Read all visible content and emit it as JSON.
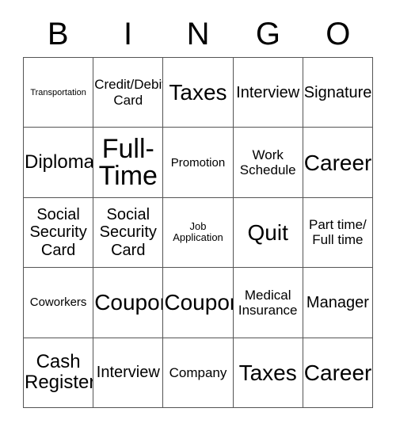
{
  "card": {
    "title": "BINGO",
    "header_letters": [
      "B",
      "I",
      "N",
      "G",
      "O"
    ],
    "colors": {
      "background": "#ffffff",
      "cell_background": "#ffffff",
      "border": "#555555",
      "text": "#000000"
    },
    "grid_size": {
      "columns": 5,
      "rows": 5
    },
    "cells": [
      [
        {
          "label": "Transportation",
          "size": "xxs"
        },
        {
          "label": "Credit/Debit\nCard",
          "size": "m"
        },
        {
          "label": "Taxes",
          "size": "xxl"
        },
        {
          "label": "Interview",
          "size": "l"
        },
        {
          "label": "Signature",
          "size": "l"
        }
      ],
      [
        {
          "label": "Diploma",
          "size": "xl"
        },
        {
          "label": "Full-\nTime",
          "size": "huge"
        },
        {
          "label": "Promotion",
          "size": "s"
        },
        {
          "label": "Work\nSchedule",
          "size": "m"
        },
        {
          "label": "Career",
          "size": "xxl"
        }
      ],
      [
        {
          "label": "Social\nSecurity\nCard",
          "size": "l"
        },
        {
          "label": "Social\nSecurity\nCard",
          "size": "l"
        },
        {
          "label": "Job\nApplication",
          "size": "xs"
        },
        {
          "label": "Quit",
          "size": "xxl"
        },
        {
          "label": "Part time/\nFull time",
          "size": "m"
        }
      ],
      [
        {
          "label": "Coworkers",
          "size": "s"
        },
        {
          "label": "Coupon",
          "size": "xxl"
        },
        {
          "label": "Coupon",
          "size": "xxl"
        },
        {
          "label": "Medical\nInsurance",
          "size": "m"
        },
        {
          "label": "Manager",
          "size": "l"
        }
      ],
      [
        {
          "label": "Cash\nRegister",
          "size": "xl"
        },
        {
          "label": "Interview",
          "size": "l"
        },
        {
          "label": "Company",
          "size": "m"
        },
        {
          "label": "Taxes",
          "size": "xxl"
        },
        {
          "label": "Career",
          "size": "xxl"
        }
      ]
    ]
  }
}
